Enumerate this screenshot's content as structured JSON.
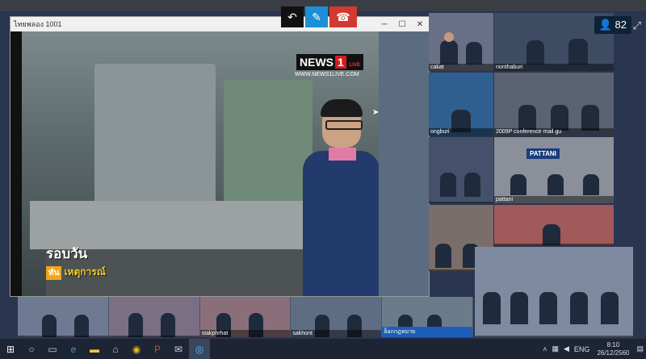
{
  "conference": {
    "participant_count": "82",
    "controls": {
      "back": "back",
      "mic": "mic-muted",
      "hangup": "hang-up"
    }
  },
  "window": {
    "title": "ไทยพลอง 1001",
    "minimize": "─",
    "maximize": "☐",
    "close": "✕"
  },
  "video": {
    "news_brand": "NEWS",
    "news_num": "1",
    "news_live": "LIVE",
    "news_url": "WWW.NEWS1LIVE.COM",
    "caption_line1": "รอบวัน",
    "caption_badge": "ทัน",
    "caption_line2": "เหตุการณ์"
  },
  "tiles": [
    {
      "label": "cakat"
    },
    {
      "label": "nonthaburi"
    },
    {
      "label": "ongburi"
    },
    {
      "label": "2009P conference mail gu"
    },
    {
      "label": ""
    },
    {
      "label": "pattani",
      "banner": "PATTANI"
    },
    {
      "label": ""
    },
    {
      "label": ""
    },
    {
      "label": ""
    }
  ],
  "strip_tiles": [
    {
      "label": ""
    },
    {
      "label": ""
    },
    {
      "label": "stakphrhat"
    },
    {
      "label": "sakhont"
    },
    {
      "label": "ล็อกกฎหมาย"
    }
  ],
  "taskbar": {
    "lang": "ENG",
    "time": "8:10",
    "date": "26/12/2560"
  }
}
